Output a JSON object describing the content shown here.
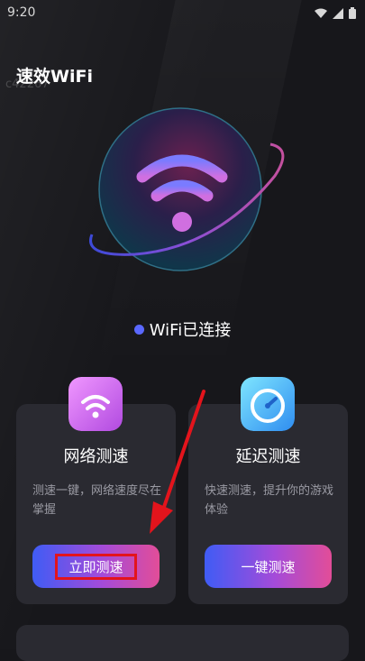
{
  "status_bar": {
    "time": "9:20",
    "icons": [
      "wifi-icon",
      "signal-icon",
      "battery-icon"
    ]
  },
  "app": {
    "title": "速效WiFi",
    "watermark": "c42267"
  },
  "connection": {
    "status_text": "WiFi已连接",
    "dot_color": "#5a68ff"
  },
  "cards": [
    {
      "title": "网络测速",
      "description": "测速一键，网络速度尽在掌握",
      "button_label": "立即测速",
      "icon": "wifi-icon"
    },
    {
      "title": "延迟测速",
      "description": "快速测速，提升你的游戏体验",
      "button_label": "一键测速",
      "icon": "speedometer-icon"
    }
  ],
  "colors": {
    "background": "#17171b",
    "card": "#2a2a31",
    "accent_blue": "#3f5cf5",
    "accent_pink": "#e24d98",
    "annotation_red": "#e3141c"
  }
}
